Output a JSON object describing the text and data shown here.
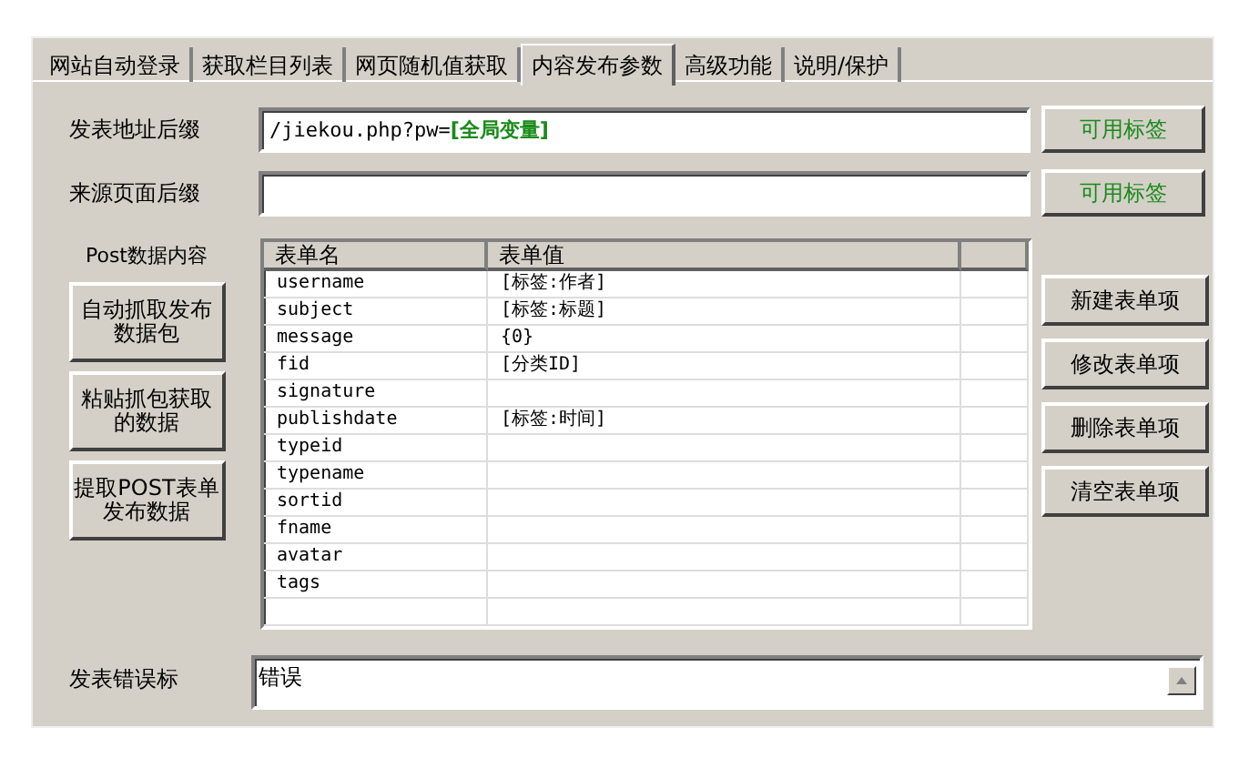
{
  "tabs": [
    {
      "label": "网站自动登录",
      "selected": false
    },
    {
      "label": "获取栏目列表",
      "selected": false
    },
    {
      "label": "网页随机值获取",
      "selected": false
    },
    {
      "label": "内容发布参数",
      "selected": true
    },
    {
      "label": "高级功能",
      "selected": false
    },
    {
      "label": "说明/保护",
      "selected": false
    }
  ],
  "url_fields": [
    {
      "label": "发表地址后缀",
      "value": "/jiekou.php?pw=**[全局变量]**",
      "button": "可用标签"
    },
    {
      "label": "来源页面后缀",
      "button": "可用标签"
    }
  ],
  "post_data": {
    "label": "Post数据内容",
    "left_buttons": [
      "自动抓取发布数据包",
      "粘贴抓包获取的数据",
      "提取POST表单发布数据"
    ],
    "table": {
      "columns": [
        "表单名",
        "表单值"
      ],
      "rows": [
        {
          "name": "username",
          "value": "[标签:作者]"
        },
        {
          "name": "subject",
          "value": "[标签:标题]"
        },
        {
          "name": "message",
          "value": "{0}"
        },
        {
          "name": "fid",
          "value": "[分类ID]"
        },
        {
          "name": "signature"
        },
        {
          "name": "publishdate",
          "value": "[标签:时间]"
        },
        {
          "name": "typeid"
        },
        {
          "name": "typename"
        },
        {
          "name": "sortid"
        },
        {
          "name": "fname"
        },
        {
          "name": "avatar"
        },
        {
          "name": "tags"
        }
      ]
    },
    "right_buttons": [
      "新建表单项",
      "修改表单项",
      "删除表单项",
      "清空表单项"
    ]
  },
  "error_marker": {
    "label": "发表错误标",
    "value": "错误"
  }
}
